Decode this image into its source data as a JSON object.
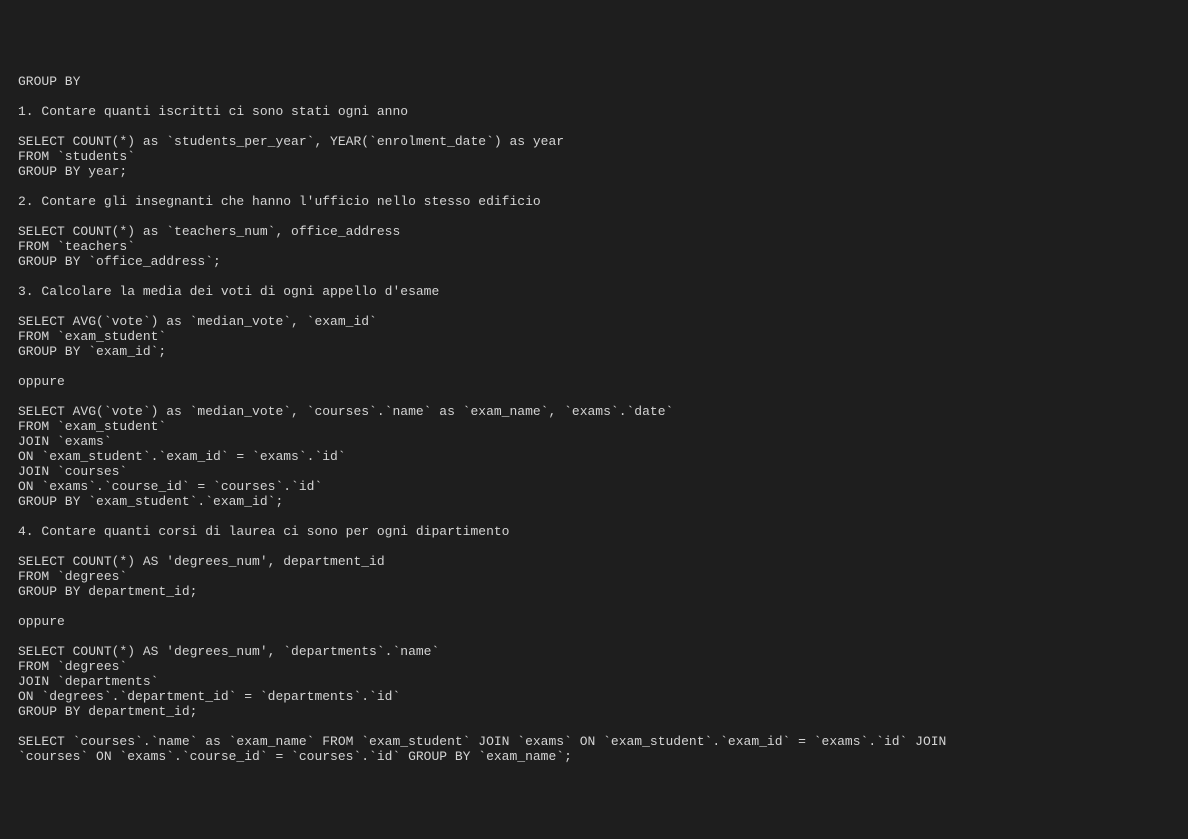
{
  "code": {
    "line0": "GROUP BY",
    "line1": "",
    "line2": "1. Contare quanti iscritti ci sono stati ogni anno",
    "line3": "",
    "line4": "SELECT COUNT(*) as `students_per_year`, YEAR(`enrolment_date`) as year",
    "line5": "FROM `students`",
    "line6": "GROUP BY year;",
    "line7": "",
    "line8": "2. Contare gli insegnanti che hanno l'ufficio nello stesso edificio",
    "line9": "",
    "line10": "SELECT COUNT(*) as `teachers_num`, office_address",
    "line11": "FROM `teachers`",
    "line12": "GROUP BY `office_address`;",
    "line13": "",
    "line14": "3. Calcolare la media dei voti di ogni appello d'esame",
    "line15": "",
    "line16": "SELECT AVG(`vote`) as `median_vote`, `exam_id`",
    "line17": "FROM `exam_student`",
    "line18": "GROUP BY `exam_id`;",
    "line19": "",
    "line20": "oppure",
    "line21": "",
    "line22": "SELECT AVG(`vote`) as `median_vote`, `courses`.`name` as `exam_name`, `exams`.`date`",
    "line23": "FROM `exam_student`",
    "line24": "JOIN `exams`",
    "line25": "ON `exam_student`.`exam_id` = `exams`.`id`",
    "line26": "JOIN `courses`",
    "line27": "ON `exams`.`course_id` = `courses`.`id`",
    "line28": "GROUP BY `exam_student`.`exam_id`;",
    "line29": "",
    "line30": "4. Contare quanti corsi di laurea ci sono per ogni dipartimento",
    "line31": "",
    "line32": "SELECT COUNT(*) AS 'degrees_num', department_id",
    "line33": "FROM `degrees`",
    "line34": "GROUP BY department_id;",
    "line35": "",
    "line36": "oppure",
    "line37": "",
    "line38": "SELECT COUNT(*) AS 'degrees_num', `departments`.`name`",
    "line39": "FROM `degrees`",
    "line40": "JOIN `departments`",
    "line41": "ON `degrees`.`department_id` = `departments`.`id`",
    "line42": "GROUP BY department_id;",
    "line43": "",
    "line44": "SELECT `courses`.`name` as `exam_name` FROM `exam_student` JOIN `exams` ON `exam_student`.`exam_id` = `exams`.`id` JOIN ",
    "line45": "`courses` ON `exams`.`course_id` = `courses`.`id` GROUP BY `exam_name`;"
  }
}
